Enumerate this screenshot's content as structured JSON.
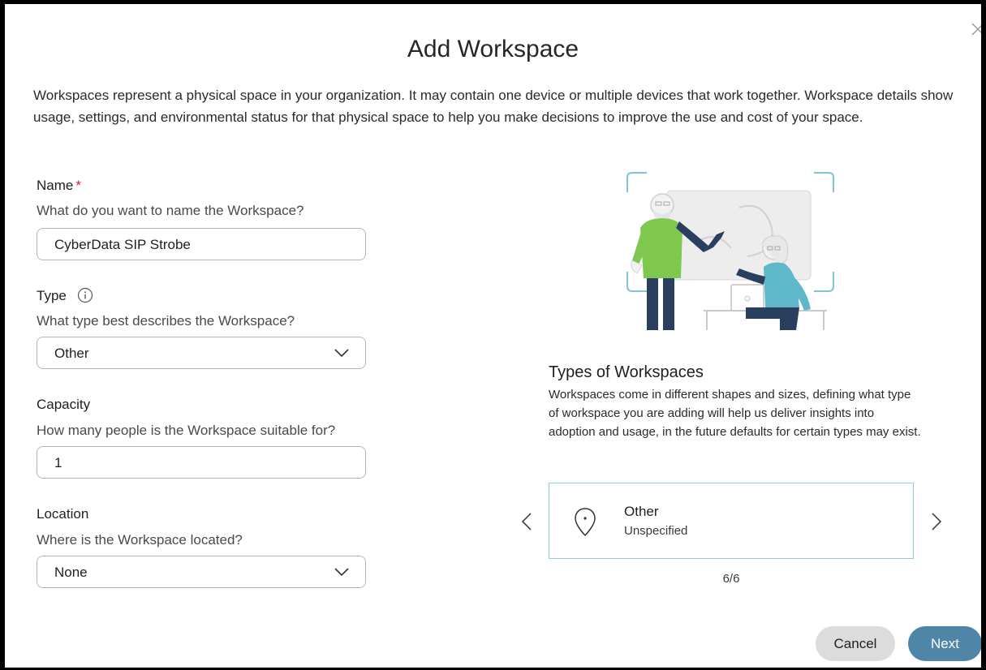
{
  "dialog": {
    "title": "Add Workspace",
    "intro": "Workspaces represent a physical space in your organization. It may contain one device or multiple devices that work together. Workspace details show usage, settings, and environmental status for that physical space to help you make decisions to improve the use and cost of your space."
  },
  "form": {
    "name": {
      "label": "Name",
      "required_mark": "*",
      "help": "What do you want to name the Workspace?",
      "value": "CyberData SIP Strobe"
    },
    "type": {
      "label": "Type",
      "help": "What type best describes the Workspace?",
      "value": "Other"
    },
    "capacity": {
      "label": "Capacity",
      "help": "How many people is the Workspace suitable for?",
      "value": "1"
    },
    "location": {
      "label": "Location",
      "help": "Where is the Workspace located?",
      "value": "None"
    }
  },
  "types_panel": {
    "title": "Types of Workspaces",
    "description": "Workspaces come in different shapes and sizes, defining what type of workspace you are adding will help us deliver insights into adoption and usage, in the future defaults for certain types may exist.",
    "card": {
      "name": "Other",
      "subtitle": "Unspecified",
      "icon": "location-pin-icon"
    },
    "pager": "6/6"
  },
  "footer": {
    "cancel_label": "Cancel",
    "next_label": "Next"
  },
  "colors": {
    "accent": "#4f86a8",
    "required": "#d4202c",
    "card_border": "#8ec9e0",
    "illustration_green": "#7ec850",
    "illustration_navy": "#2a3f5f",
    "illustration_teal": "#5fb8c9"
  }
}
